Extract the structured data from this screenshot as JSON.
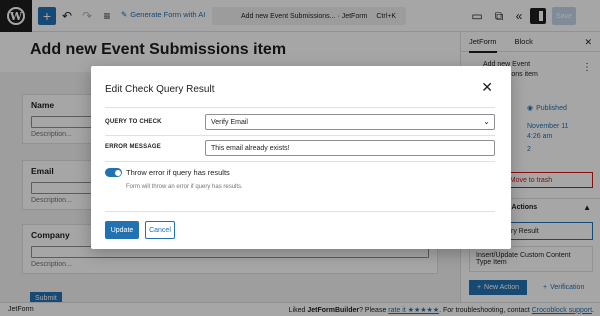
{
  "toolbar": {
    "logo_letter": "W",
    "add_symbol": "+",
    "generate_label": "Generate Form with AI",
    "document_title": "Add new Event Submissions... · JetForm",
    "shortcut": "Ctrl+K",
    "save_label": "Save"
  },
  "editor": {
    "page_title": "Add new Event Submissions item",
    "fields": [
      {
        "label": "Name",
        "description": "Description..."
      },
      {
        "label": "Email",
        "description": "Description..."
      },
      {
        "label": "Company",
        "description": "Description..."
      }
    ],
    "submit_label": "Submit"
  },
  "sidebar": {
    "tabs": [
      "JetForm",
      "Block"
    ],
    "post_title_line1": "Add new Event",
    "post_title_line2": "Submissions item",
    "status": "Published",
    "date_line1": "November 11",
    "date_line2": "4:26 am",
    "revisions": "2",
    "trash_label": "Move to trash",
    "actions_heading": "Post Submit Actions",
    "actions": [
      "Check Query Result",
      "Insert/Update Custom Content Type Item"
    ],
    "new_action_label": "New Action",
    "verification_label": "Verification"
  },
  "footer": {
    "left": "JetForm",
    "liked_prefix": "Liked ",
    "liked_brand": "JetFormBuilder",
    "liked_mid": "? Please ",
    "rate_link": "rate it ★★★★★",
    "troubleshoot_prefix": ". For troubleshooting, contact ",
    "support_link": "Crocoblock support",
    "troubleshoot_suffix": "."
  },
  "modal": {
    "title": "Edit Check Query Result",
    "query_label": "QUERY TO CHECK",
    "query_value": "Verify Email",
    "error_label": "ERROR MESSAGE",
    "error_value": "This email already exists!",
    "toggle_on": true,
    "toggle_label": "Throw error if query has results",
    "toggle_help": "Form will throw an error if query has results.",
    "update_label": "Update",
    "cancel_label": "Cancel"
  },
  "colors": {
    "accent": "#2271b1",
    "overlay": "rgba(0,0,0,0.35)",
    "danger": "#cc1818"
  }
}
